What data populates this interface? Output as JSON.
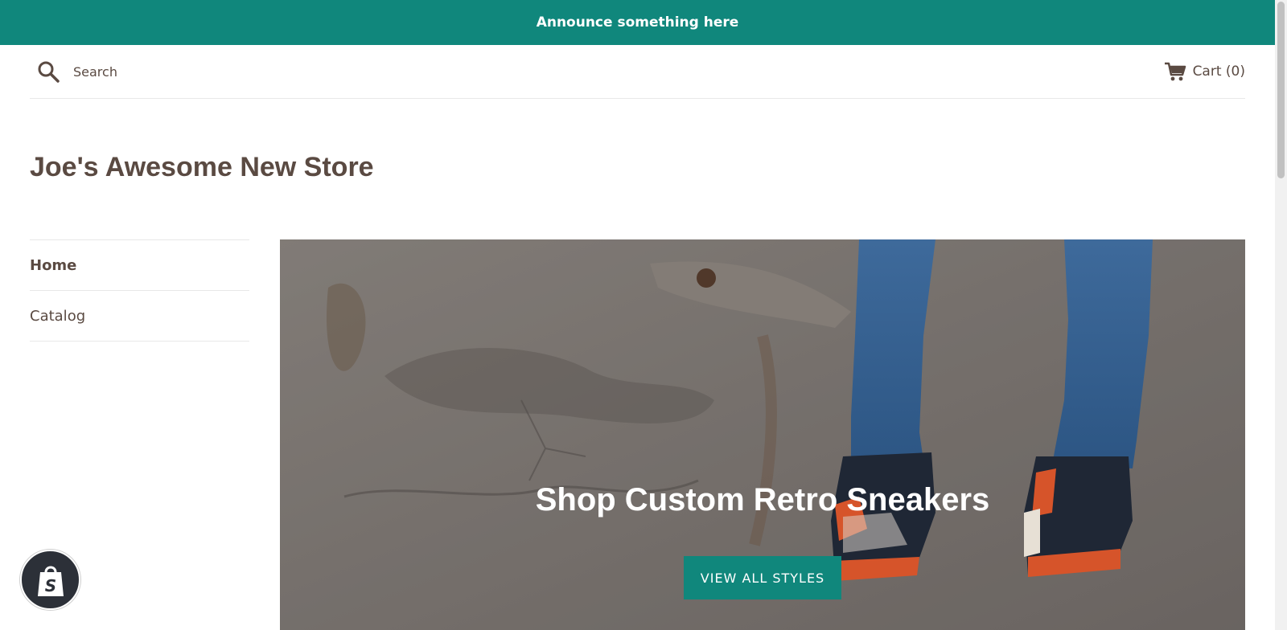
{
  "announcement": {
    "text": "Announce something here"
  },
  "header": {
    "search_placeholder": "Search",
    "cart_label": "Cart (0)",
    "search_icon": "search-icon",
    "cart_icon": "cart-icon"
  },
  "store": {
    "title": "Joe's Awesome New Store"
  },
  "sidebar": {
    "items": [
      {
        "label": "Home",
        "active": true
      },
      {
        "label": "Catalog",
        "active": false
      }
    ]
  },
  "hero": {
    "title": "Shop Custom Retro Sneakers",
    "button_label": "VIEW ALL STYLES"
  },
  "badge": {
    "icon": "shopify-bag-icon"
  },
  "colors": {
    "accent": "#10877c",
    "text": "#5a4a42",
    "divider": "#e8e8e8"
  }
}
